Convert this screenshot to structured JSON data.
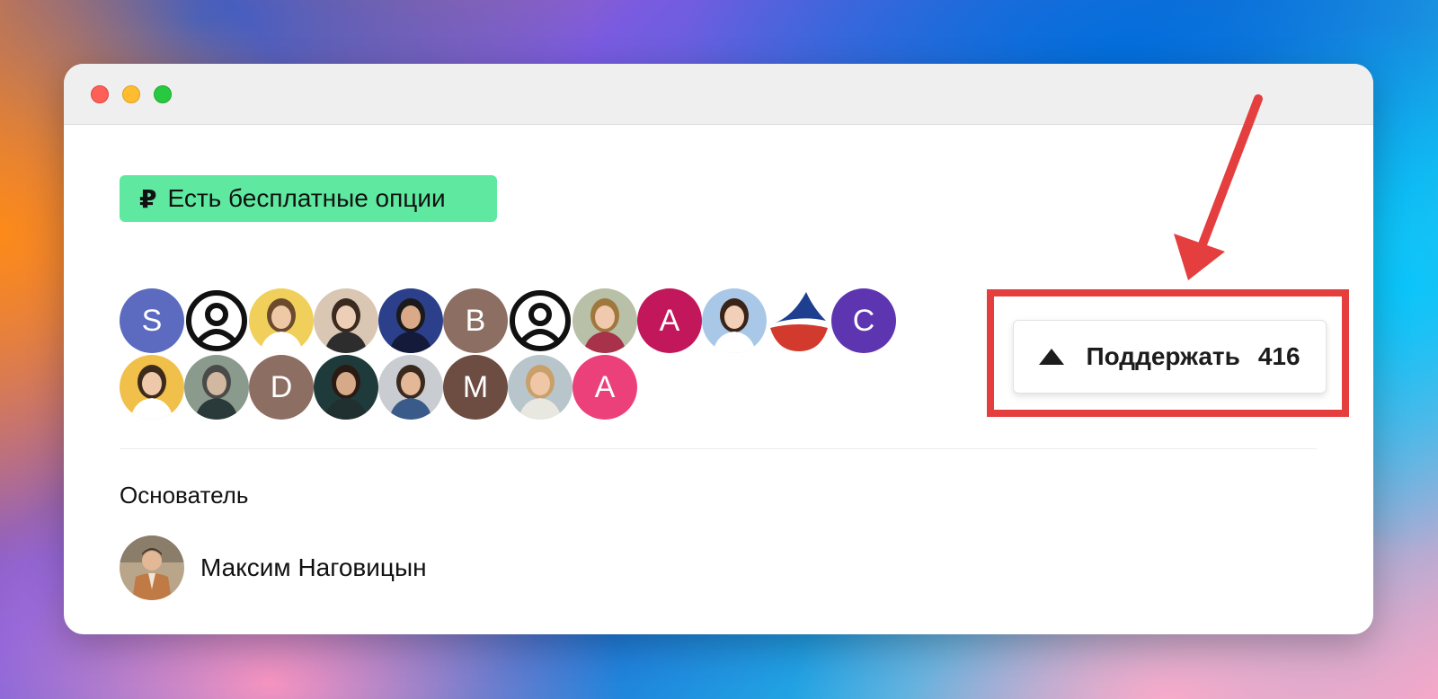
{
  "window": {
    "controls": [
      "close",
      "minimize",
      "zoom"
    ]
  },
  "badge": {
    "icon": "₽",
    "label": "Есть бесплатные опции",
    "color": "#5ee8a0"
  },
  "supporters": {
    "row1": [
      {
        "type": "letter",
        "letter": "S",
        "color": "#5c6bc0"
      },
      {
        "type": "default-icon"
      },
      {
        "type": "photo",
        "icon": "woman-yellow-bg"
      },
      {
        "type": "photo",
        "icon": "woman-beige-bg"
      },
      {
        "type": "photo",
        "icon": "woman-blue-bg"
      },
      {
        "type": "letter",
        "letter": "B",
        "color": "#8d6e63"
      },
      {
        "type": "default-icon"
      },
      {
        "type": "photo",
        "icon": "girl-photo"
      },
      {
        "type": "letter",
        "letter": "A",
        "color": "#c2185b"
      },
      {
        "type": "photo",
        "icon": "woman-white-coat"
      },
      {
        "type": "logo",
        "icon": "blue-red-logo"
      },
      {
        "type": "letter",
        "letter": "C",
        "color": "#5e35b1"
      }
    ],
    "row2": [
      {
        "type": "photo",
        "icon": "woman-phone"
      },
      {
        "type": "photo",
        "icon": "couple-outdoor"
      },
      {
        "type": "letter",
        "letter": "D",
        "color": "#8d6e63"
      },
      {
        "type": "photo",
        "icon": "man-glasses"
      },
      {
        "type": "photo",
        "icon": "man-portrait"
      },
      {
        "type": "letter",
        "letter": "M",
        "color": "#6d4c41"
      },
      {
        "type": "photo",
        "icon": "child-beach"
      },
      {
        "type": "letter",
        "letter": "A",
        "color": "#ec407a"
      }
    ]
  },
  "support_button": {
    "icon": "upvote-triangle-icon",
    "label": "Поддержать",
    "count": "416"
  },
  "founder": {
    "section_title": "Основатель",
    "name": "Максим Наговицын"
  },
  "annotation": {
    "color": "#e53e3e"
  }
}
